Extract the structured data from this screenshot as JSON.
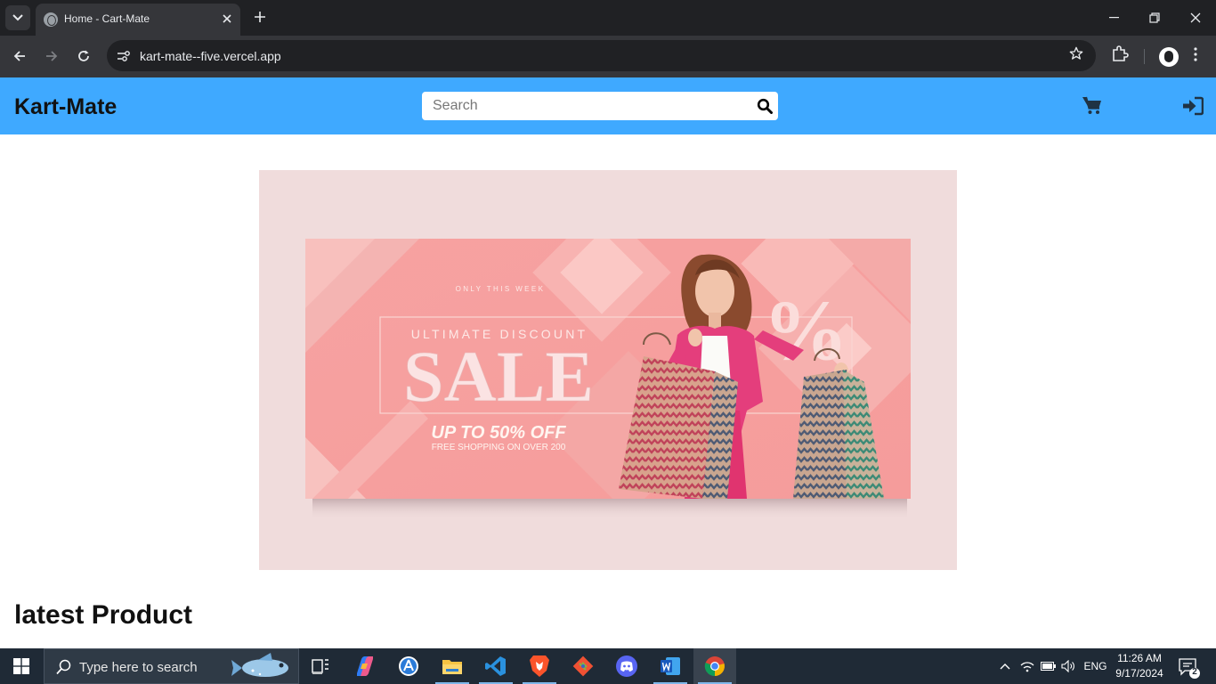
{
  "browser": {
    "tab_title": "Home - Cart-Mate",
    "url": "kart-mate--five.vercel.app"
  },
  "site": {
    "brand": "Kart-Mate",
    "search_placeholder": "Search",
    "accent_color": "#3fa9ff",
    "nav_icons": [
      "shopping-cart-icon",
      "sign-in-icon"
    ]
  },
  "banner": {
    "top_text": "ONLY THIS WEEK",
    "kicker": "ULTIMATE DISCOUNT",
    "headline": "SALE",
    "offer": "UP TO 50% OFF",
    "subtext": "FREE SHOPPING ON OVER 200",
    "decor_symbol": "%"
  },
  "main": {
    "section_heading": "latest Product"
  },
  "taskbar": {
    "search_placeholder": "Type here to search",
    "apps": [
      "task-view",
      "copilot",
      "app-store",
      "file-explorer",
      "vs-code",
      "brave",
      "git",
      "discord",
      "word",
      "chrome"
    ],
    "language": "ENG",
    "time": "11:26 AM",
    "date": "9/17/2024",
    "notification_count": "2"
  }
}
